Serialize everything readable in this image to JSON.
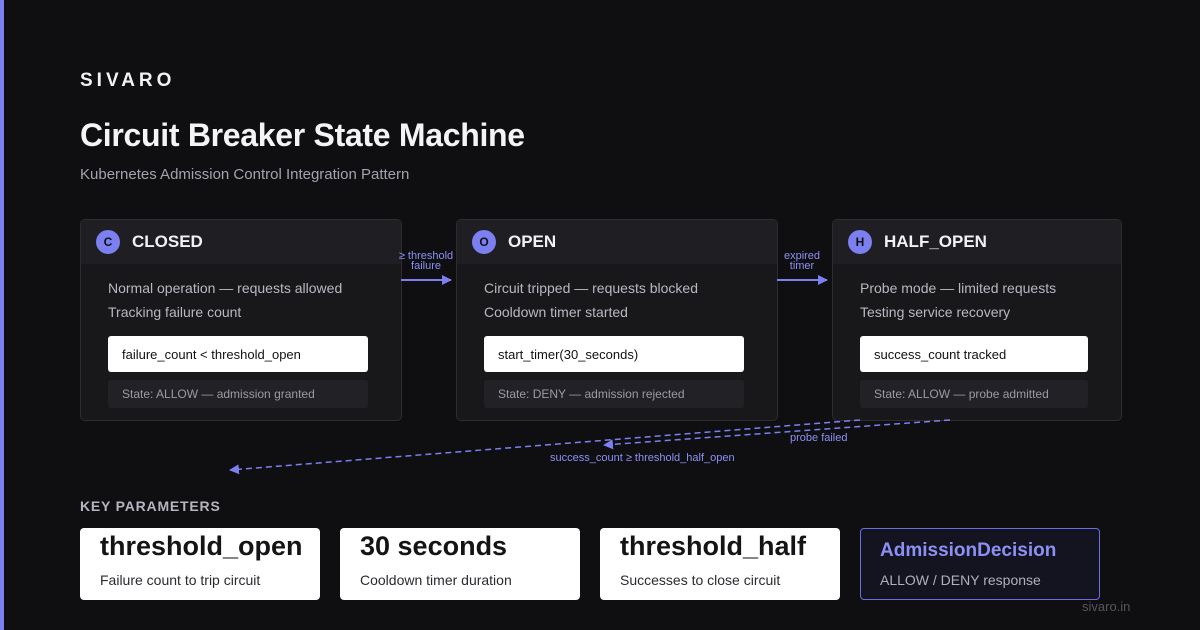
{
  "brand": "SIVARO",
  "title": "Circuit Breaker State Machine",
  "subtitle": "Kubernetes Admission Control Integration Pattern",
  "states": [
    {
      "badge": "C",
      "name": "CLOSED",
      "desc1": "Normal operation — requests allowed",
      "desc2": "Tracking failure count",
      "code": "failure_count < threshold_open",
      "state_line": "State: ALLOW — admission granted"
    },
    {
      "badge": "O",
      "name": "OPEN",
      "desc1": "Circuit tripped — requests blocked",
      "desc2": "Cooldown timer started",
      "code": "start_timer(30_seconds)",
      "state_line": "State: DENY — admission rejected"
    },
    {
      "badge": "H",
      "name": "HALF_OPEN",
      "desc1": "Probe mode — limited requests",
      "desc2": "Testing service recovery",
      "code": "success_count tracked",
      "state_line": "State: ALLOW — probe admitted"
    }
  ],
  "transitions": {
    "closed_to_open": {
      "line1": "≥ threshold",
      "line2": "failure"
    },
    "open_to_half": {
      "line1": "expired",
      "line2": "timer"
    },
    "probe_failed": "probe failed",
    "half_to_closed": "success_count ≥ threshold_half_open"
  },
  "key_parameters": {
    "heading": "KEY PARAMETERS",
    "items": [
      {
        "title": "threshold_open",
        "desc": "Failure count to trip circuit"
      },
      {
        "title": "30 seconds",
        "desc": "Cooldown timer duration"
      },
      {
        "title": "threshold_half",
        "desc": "Successes to close circuit"
      },
      {
        "title": "AdmissionDecision",
        "desc": "ALLOW / DENY response"
      }
    ]
  },
  "footer": "sivaro.in",
  "colors": {
    "accent": "#7b7ff0",
    "background": "#0f0f12",
    "card": "#18181b"
  }
}
